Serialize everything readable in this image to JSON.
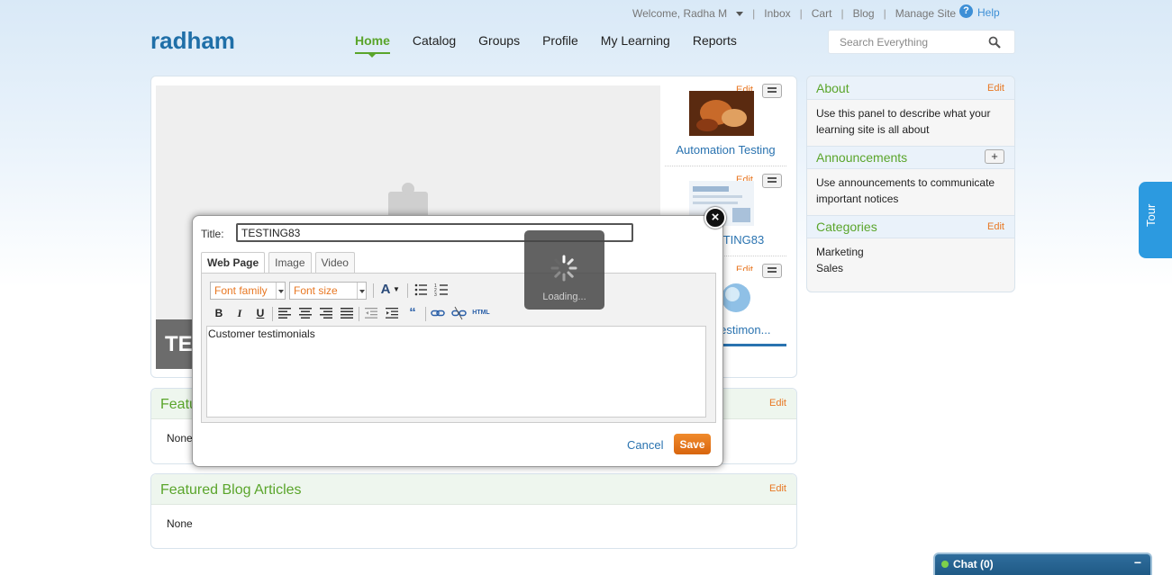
{
  "header": {
    "welcome": "Welcome, Radha M",
    "links": [
      "Inbox",
      "Cart",
      "Blog",
      "Manage Site"
    ],
    "help": "Help",
    "brand": "radham",
    "nav": [
      "Home",
      "Catalog",
      "Groups",
      "Profile",
      "My Learning",
      "Reports"
    ],
    "active_nav": "Home",
    "search_placeholder": "Search Everything"
  },
  "slideshow": {
    "caption": "TE",
    "items": [
      {
        "edit": "Edit",
        "label": "Automation Testing"
      },
      {
        "edit": "Edit",
        "label": "TING83"
      },
      {
        "edit": "Edit",
        "label": "testimon..."
      }
    ]
  },
  "featured": {
    "courses": {
      "title": "Featu",
      "edit": "Edit",
      "body": "None"
    },
    "blog": {
      "title": "Featured Blog Articles",
      "edit": "Edit",
      "body": "None"
    }
  },
  "sidebar": {
    "about": {
      "title": "About",
      "edit": "Edit",
      "text": "Use this panel to describe what your learning site is all about"
    },
    "announcements": {
      "title": "Announcements",
      "plus": "+",
      "text": "Use announcements to communicate important notices"
    },
    "categories": {
      "title": "Categories",
      "edit": "Edit",
      "items": [
        "Marketing",
        "Sales"
      ]
    }
  },
  "tour": "Tour",
  "chat": {
    "label": "Chat  (0)",
    "minimize": "−"
  },
  "modal": {
    "title_label": "Title:",
    "title_value": "TESTING83",
    "tabs": [
      "Web Page",
      "Image",
      "Video"
    ],
    "active_tab": "Web Page",
    "font_family": "Font family",
    "font_size": "Font size",
    "html_button": "HTML",
    "content": "Customer testimonials",
    "cancel": "Cancel",
    "save": "Save",
    "close": "×"
  },
  "loading": "Loading...",
  "colors": {
    "brand": "#1f6fa8",
    "accent_green": "#5aa52b",
    "edit_orange": "#e87722",
    "tour_blue": "#2c9ae0",
    "chat_bar": "#1f5a86"
  }
}
